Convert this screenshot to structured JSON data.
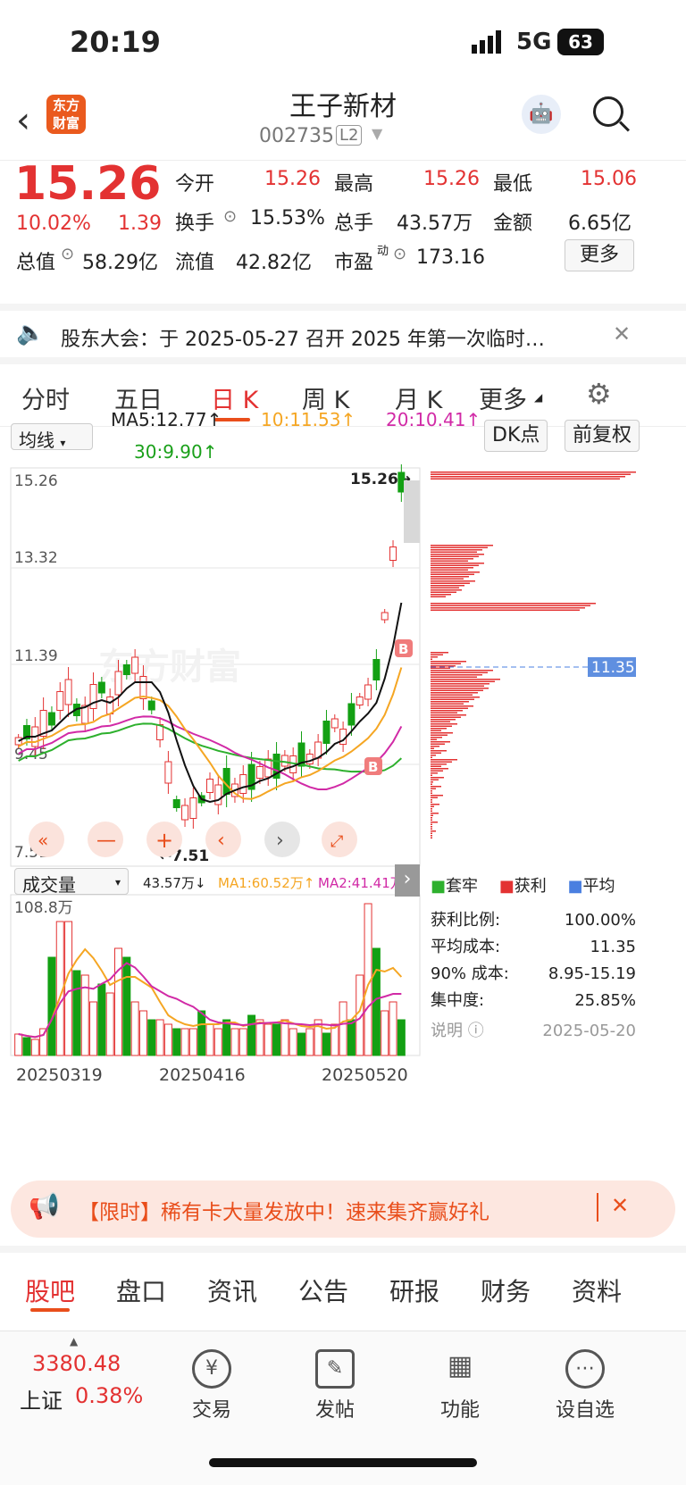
{
  "status": {
    "time": "20:19",
    "network": "5G",
    "battery": "63"
  },
  "header": {
    "logo": "东方财富",
    "title": "王子新材",
    "code": "002735",
    "level": "L2"
  },
  "quote": {
    "price": "15.26",
    "change_pct": "10.02%",
    "change": "1.39",
    "fields": [
      {
        "label": "今开",
        "value": "15.26",
        "red": true
      },
      {
        "label": "最高",
        "value": "15.26",
        "red": true
      },
      {
        "label": "最低",
        "value": "15.06",
        "red": true
      },
      {
        "label": "换手",
        "value": "15.53%"
      },
      {
        "label": "总手",
        "value": "43.57万"
      },
      {
        "label": "金额",
        "value": "6.65亿"
      },
      {
        "label": "总值",
        "value": "58.29亿"
      },
      {
        "label": "流值",
        "value": "42.82亿"
      },
      {
        "label": "市盈",
        "value": "173.16",
        "sup": "动"
      }
    ],
    "more": "更多"
  },
  "notice": {
    "text": "股东大会：于 2025-05-27 召开 2025 年第一次临时…"
  },
  "tabs": [
    "分时",
    "五日",
    "日 K",
    "周 K",
    "月 K",
    "更多"
  ],
  "active_tab": "日 K",
  "ma_bar": {
    "selector": "均线",
    "ma5": "MA5:12.77↑",
    "ma10": "10:11.53↑",
    "ma20": "20:10.41↑",
    "ma30": "30:9.90↑",
    "dk": "DK点",
    "fq": "前复权"
  },
  "kchart": {
    "y_labels": [
      "15.26",
      "13.32",
      "11.39",
      "9.45",
      "7.51"
    ],
    "high_label": "15.26→",
    "low_label": "←7.51",
    "watermark": "东方财富",
    "marker": "B"
  },
  "chip": {
    "current_label": "11.35",
    "legend": [
      "套牢",
      "获利",
      "平均"
    ],
    "rows": [
      {
        "label": "获利比例:",
        "value": "100.00%"
      },
      {
        "label": "平均成本:",
        "value": "11.35"
      },
      {
        "label": "90% 成本:",
        "value": "8.95-15.19"
      },
      {
        "label": "集中度:",
        "value": "25.85%"
      }
    ],
    "explain": "说明",
    "date": "2025-05-20"
  },
  "vol_bar": {
    "selector": "成交量",
    "vol": "43.57万↓",
    "ma1": "MA1:60.52万↑",
    "ma2": "MA2:41.41万↑",
    "max": "108.8万"
  },
  "x_labels": [
    "20250319",
    "20250416",
    "20250520"
  ],
  "colors": {
    "up": "#e33232",
    "down": "#13a013",
    "ma5": "#111111",
    "ma10": "#f5a623",
    "ma20": "#d12aa6",
    "ma30": "#2db02d",
    "accent": "#e94e1b"
  },
  "promo": {
    "text": "【限时】稀有卡大量发放中！速来集齐赢好礼"
  },
  "bottom_tabs": [
    "股吧",
    "盘口",
    "资讯",
    "公告",
    "研报",
    "财务",
    "资料"
  ],
  "nav": {
    "index_value": "3380.48",
    "index_name": "上证",
    "index_pct": "0.38%",
    "items": [
      {
        "label": "交易",
        "icon": "yen-icon"
      },
      {
        "label": "发帖",
        "icon": "edit-icon"
      },
      {
        "label": "功能",
        "icon": "grid-icon"
      },
      {
        "label": "设自选",
        "icon": "more-icon"
      }
    ]
  }
}
